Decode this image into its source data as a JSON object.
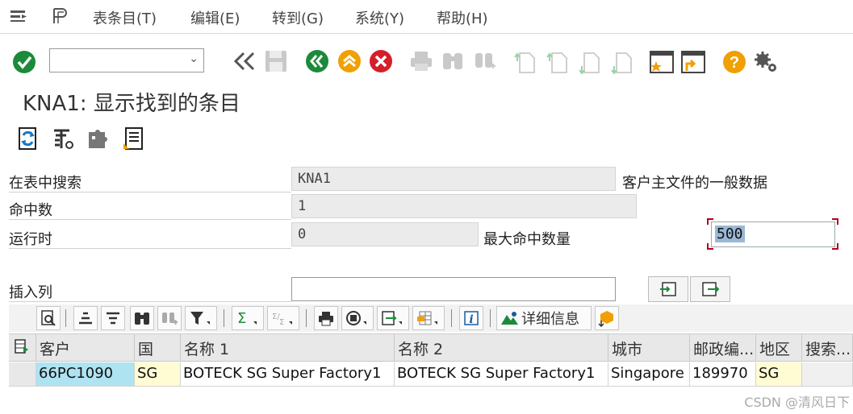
{
  "menu": {
    "items": [
      {
        "label": "表条目(T)"
      },
      {
        "label": "编辑(E)"
      },
      {
        "label": "转到(G)"
      },
      {
        "label": "系统(Y)"
      },
      {
        "label": "帮助(H)"
      }
    ]
  },
  "page": {
    "title": "KNA1: 显示找到的条目"
  },
  "form": {
    "search_table_label": "在表中搜索",
    "search_table_value": "KNA1",
    "search_table_desc": "客户主文件的一般数据",
    "hits_label": "命中数",
    "hits_value": "1",
    "runtime_label": "运行时",
    "runtime_value": "0",
    "max_hits_label": "最大命中数量",
    "max_hits_value": "500",
    "insert_col_label": "插入列",
    "insert_col_value": ""
  },
  "grid_toolbar": {
    "details_label": "详细信息"
  },
  "grid": {
    "columns": [
      "客户",
      "国",
      "名称 1",
      "名称 2",
      "城市",
      "邮政编...",
      "地区",
      "搜索..."
    ],
    "rows": [
      [
        "66PC1090",
        "SG",
        "BOTECK SG Super Factory1",
        "BOTECK SG Super Factory1",
        "Singapore",
        "189970",
        "SG",
        ""
      ]
    ]
  },
  "colors": {
    "accent_green": "#1c8a3a",
    "accent_orange": "#f0a000",
    "accent_red": "#d41f2b",
    "highlight_blue": "#aee3f2",
    "highlight_yellow": "#fffbd2"
  },
  "watermark": "CSDN @清风日下"
}
